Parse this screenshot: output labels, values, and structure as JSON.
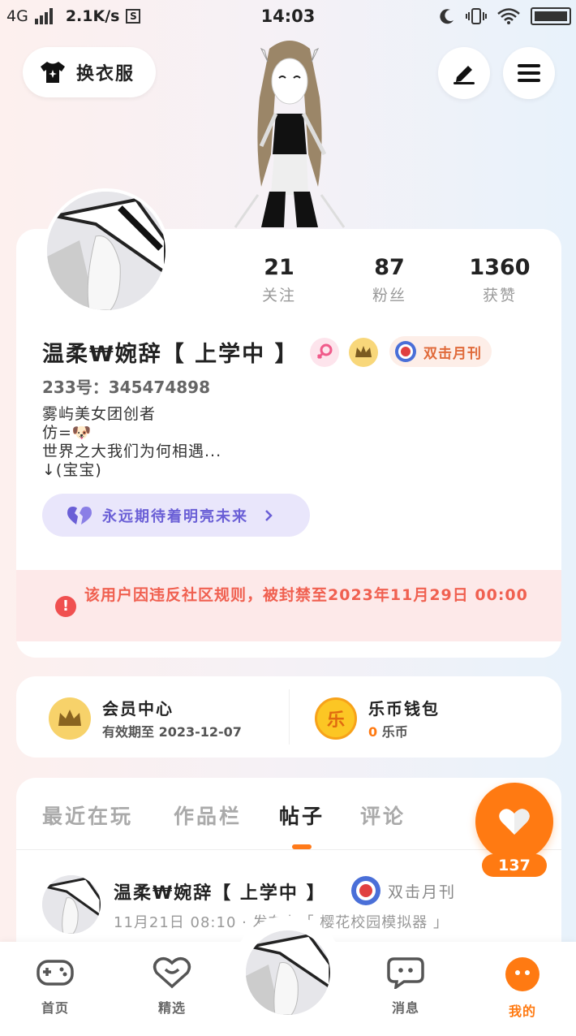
{
  "status_bar": {
    "network": "4G",
    "speed": "2.1K/s",
    "s_icon": "S",
    "time": "14:03"
  },
  "header": {
    "outfit_label": "换衣服",
    "edit_icon": "pencil-icon",
    "menu_icon": "hamburger-menu-icon"
  },
  "profile": {
    "stats": [
      {
        "value": "21",
        "label": "关注"
      },
      {
        "value": "87",
        "label": "粉丝"
      },
      {
        "value": "1360",
        "label": "获赞"
      }
    ],
    "username": "温柔₩婉辞【 上学中 】",
    "monthly_badge": "双击月刊",
    "uid": "233号：345474898",
    "bio_lines": [
      "雾屿美女团创者",
      "仿=",
      "世界之大我们为何相遇...",
      "↓(宝宝)"
    ],
    "bio_emoji": "🐶",
    "motto": "永远期待着明亮未来",
    "ban_notice": "该用户因违反社区规则，被封禁至2023年11月29日 00:00"
  },
  "wallet": {
    "vip_title": "会员中心",
    "vip_sub": "有效期至 2023-12-07",
    "coin_title": "乐币钱包",
    "coin_amount": "0",
    "coin_unit": "乐币",
    "coin_glyph": "乐"
  },
  "tabs": [
    "最近在玩",
    "作品栏",
    "帖子",
    "评论"
  ],
  "active_tab": "帖子",
  "like_count": "137",
  "post": {
    "author": "温柔₩婉辞【 上学中 】",
    "badge": "双击月刊",
    "meta": "11月21日 08:10 · 发布在「 樱花校园模拟器 」"
  },
  "bottom_nav": [
    {
      "label": "首页",
      "icon": "gamepad-icon"
    },
    {
      "label": "精选",
      "icon": "heart-badge-icon"
    },
    {
      "label": "消息",
      "icon": "chat-icon"
    },
    {
      "label": "我的",
      "icon": "profile-face-icon"
    }
  ],
  "colors": {
    "accent": "#ff7a12",
    "ban_red": "#f05050",
    "motto_purple": "#6a5fd6"
  }
}
